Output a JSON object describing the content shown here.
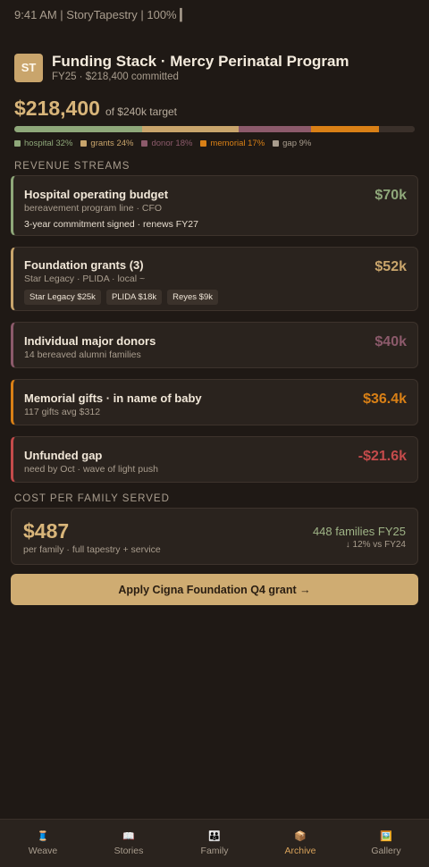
{
  "status_bar": "9:41 AM | StoryTapestry | 100% ▎",
  "header": {
    "avatar": "ST",
    "title": "Funding Stack · Mercy Perinatal Program",
    "subtitle": "FY25 · $218,400 committed"
  },
  "totals": {
    "amount": "$218,400",
    "target": "of $240k target"
  },
  "stack": [
    {
      "name": "hospital",
      "percent": 32,
      "color": "#8fa87a"
    },
    {
      "name": "grants",
      "percent": 24,
      "color": "#c9a56c"
    },
    {
      "name": "donor",
      "percent": 18,
      "color": "#8c5a6b"
    },
    {
      "name": "memorial",
      "percent": 17,
      "color": "#d98016"
    },
    {
      "name": "gap",
      "percent": 9,
      "color": "#3a302a"
    }
  ],
  "legend": [
    {
      "label": "hospital 32%",
      "color": "#8fa87a"
    },
    {
      "label": "grants 24%",
      "color": "#c9a56c"
    },
    {
      "label": "donor 18%",
      "color": "#8c5a6b"
    },
    {
      "label": "memorial 17%",
      "color": "#d98016"
    },
    {
      "label": "gap 9%",
      "color": "#a99d8e"
    }
  ],
  "sections": {
    "revenue": "REVENUE STREAMS",
    "cost": "COST PER FAMILY SERVED"
  },
  "streams": [
    {
      "name": "Hospital operating budget",
      "sub": "bereavement program line · CFO",
      "note": "3-year commitment signed · renews FY27",
      "amount": "$70k",
      "color": "#8fa87a"
    },
    {
      "name": "Foundation grants (3)",
      "sub": "Star Legacy · PLIDA · local ~",
      "chips": [
        "Star Legacy $25k",
        "PLIDA $18k",
        "Reyes $9k"
      ],
      "amount": "$52k",
      "color": "#c9a56c"
    },
    {
      "name": "Individual major donors",
      "sub": "14 bereaved alumni families",
      "amount": "$40k",
      "color": "#8c5a6b"
    },
    {
      "name": "Memorial gifts · in name of baby",
      "sub": "117 gifts avg $312",
      "amount": "$36.4k",
      "color": "#d98016"
    },
    {
      "name": "Unfunded gap",
      "sub": "need by Oct · wave of light push",
      "amount": "-$21.6k",
      "color": "#c44b4b"
    }
  ],
  "cost": {
    "amount": "$487",
    "label": "per family · full tapestry + service",
    "families": "448 families FY25",
    "trend": "↓ 12% vs FY24"
  },
  "cta_label": "Apply Cigna Foundation Q4 grant →",
  "tabs": [
    {
      "label": "Weave",
      "icon": "🧵",
      "icon_name": "thread-icon"
    },
    {
      "label": "Stories",
      "icon": "📖",
      "icon_name": "book-icon"
    },
    {
      "label": "Family",
      "icon": "👪",
      "icon_name": "family-icon"
    },
    {
      "label": "Archive",
      "icon": "📦",
      "icon_name": "box-icon",
      "active": true
    },
    {
      "label": "Gallery",
      "icon": "🖼️",
      "icon_name": "picture-icon"
    }
  ]
}
